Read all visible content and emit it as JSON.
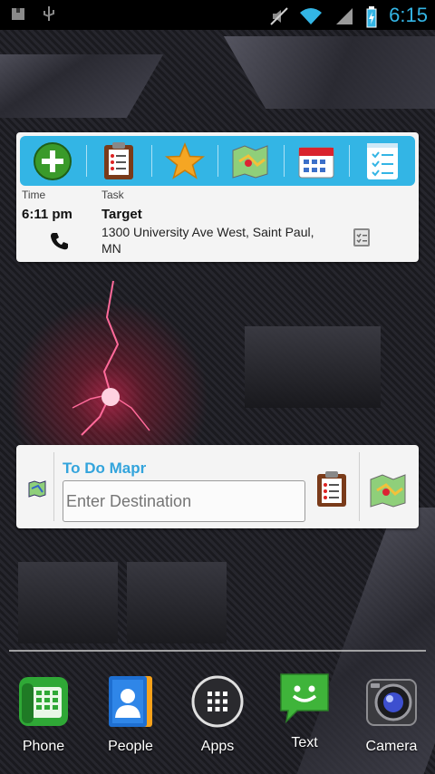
{
  "status_bar": {
    "time": "6:15",
    "left_icons": [
      "package-icon",
      "usb-icon"
    ],
    "right_icons": [
      "mute-icon",
      "wifi-icon",
      "signal-icon",
      "battery-charging-icon"
    ],
    "accent_color": "#33b5e5"
  },
  "task_widget": {
    "toolbar_color": "#33b5e5",
    "toolbar_buttons": [
      "add-icon",
      "clipboard-icon",
      "star-icon",
      "map-icon",
      "calendar-icon",
      "checklist-icon"
    ],
    "time_header": "Time",
    "task_header": "Task",
    "time_value": "6:11 pm",
    "task_name": "Target",
    "task_address": "1300 University Ave West, Saint Paul, MN"
  },
  "mapr_widget": {
    "title": "To Do Mapr",
    "destination_placeholder": "Enter Destination",
    "title_color": "#33a4dc"
  },
  "dock": {
    "items": [
      {
        "label": "Phone",
        "icon": "phone-icon"
      },
      {
        "label": "People",
        "icon": "contacts-icon"
      },
      {
        "label": "Apps",
        "icon": "apps-grid-icon"
      },
      {
        "label": "Text",
        "icon": "messaging-icon"
      },
      {
        "label": "Camera",
        "icon": "camera-icon"
      }
    ]
  }
}
